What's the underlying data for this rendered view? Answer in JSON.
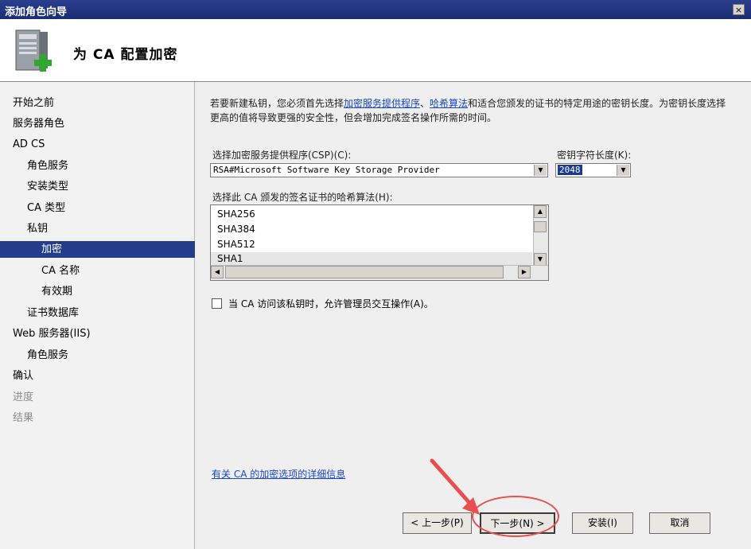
{
  "window": {
    "title": "添加角色向导",
    "close_label": "×"
  },
  "header": {
    "title": "为 CA 配置加密"
  },
  "nav": {
    "items": [
      {
        "label": "开始之前",
        "state": "normal"
      },
      {
        "label": "服务器角色",
        "state": "normal"
      },
      {
        "label": "AD CS",
        "state": "normal"
      },
      {
        "label": "角色服务",
        "state": "normal"
      },
      {
        "label": "安装类型",
        "state": "normal"
      },
      {
        "label": "CA 类型",
        "state": "normal"
      },
      {
        "label": "私钥",
        "state": "normal"
      },
      {
        "label": "加密",
        "state": "selected"
      },
      {
        "label": "CA 名称",
        "state": "normal"
      },
      {
        "label": "有效期",
        "state": "normal"
      },
      {
        "label": "证书数据库",
        "state": "normal"
      },
      {
        "label": "Web 服务器(IIS)",
        "state": "normal"
      },
      {
        "label": "角色服务",
        "state": "normal"
      },
      {
        "label": "确认",
        "state": "normal"
      },
      {
        "label": "进度",
        "state": "disabled"
      },
      {
        "label": "结果",
        "state": "disabled"
      }
    ]
  },
  "description": {
    "part1": "若要新建私钥，您必须首先选择",
    "link1": "加密服务提供程序",
    "sep": "、",
    "link2": "哈希算法",
    "part2": "和适合您颁发的证书的特定用途的密钥长度。为密钥长度选择更高的值将导致更强的安全性，但会增加完成签名操作所需的时间。"
  },
  "csp": {
    "label": "选择加密服务提供程序(CSP)(C):",
    "value": "RSA#Microsoft Software Key Storage Provider"
  },
  "key_length": {
    "label": "密钥字符长度(K):",
    "value": "2048"
  },
  "hash": {
    "label": "选择此 CA 颁发的签名证书的哈希算法(H):",
    "items": [
      "SHA256",
      "SHA384",
      "SHA512",
      "SHA1"
    ],
    "selected": "SHA1"
  },
  "checkbox": {
    "label": "当 CA 访问该私钥时，允许管理员交互操作(A)。",
    "checked": false
  },
  "more_link": "有关 CA 的加密选项的详细信息",
  "buttons": {
    "back": "< 上一步(P)",
    "next": "下一步(N) >",
    "install": "安装(I)",
    "cancel": "取消"
  },
  "colors": {
    "titlebar": "#1a2c72",
    "selection": "#243c8a",
    "link": "#1a47c8",
    "annotation": "#e85050"
  }
}
